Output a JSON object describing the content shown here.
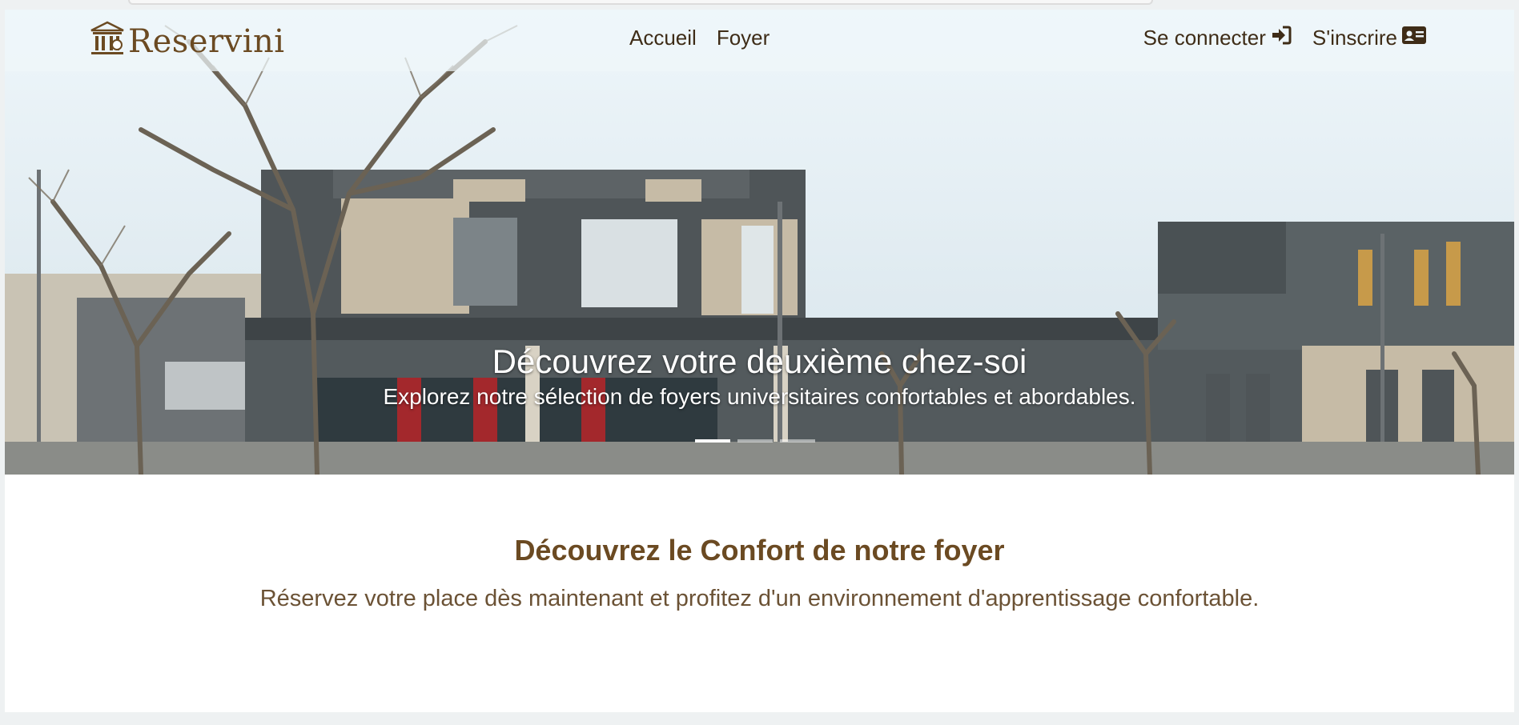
{
  "brand": {
    "name": "Reservini",
    "icon": "building-columns-icon",
    "color": "#6b4a22"
  },
  "nav": {
    "links": [
      "Accueil",
      "Foyer"
    ]
  },
  "auth": {
    "login_label": "Se connecter",
    "login_icon": "sign-in-icon",
    "signup_label": "S'inscrire",
    "signup_icon": "id-card-icon"
  },
  "hero": {
    "title": "Découvrez votre deuxième chez-soi",
    "subtitle": "Explorez notre sélection de foyers universitaires confortables et abordables.",
    "slides_count": 3,
    "active_slide": 1
  },
  "section": {
    "title": "Découvrez le Confort de notre foyer",
    "subtitle": "Réservez votre place dès maintenant et profitez d'un environnement d'apprentissage confortable."
  }
}
